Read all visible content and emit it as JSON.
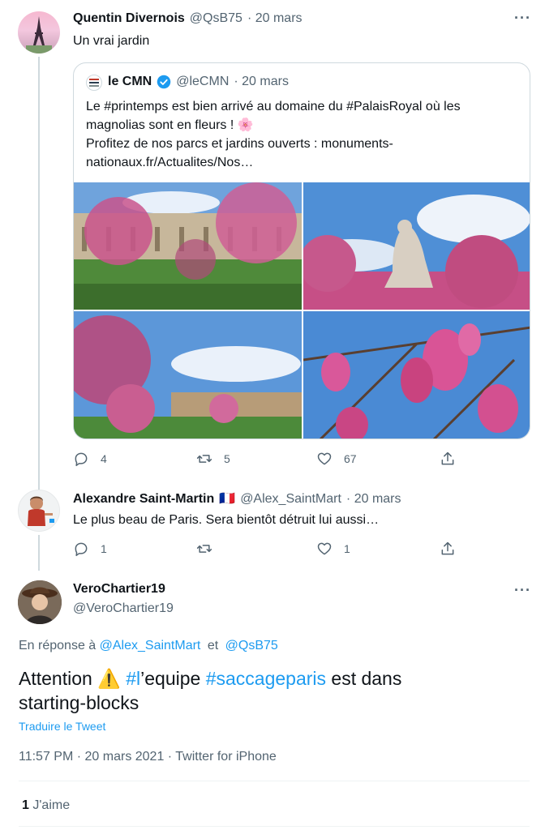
{
  "tweet1": {
    "name": "Quentin Divernois",
    "handle": "@QsB75",
    "date": "· 20 mars",
    "text": "Un vrai jardin",
    "more": "···"
  },
  "quoted": {
    "name": "le CMN",
    "handle": "@leCMN",
    "date": "· 20 mars",
    "line1_pre": "Le ",
    "line1_tag1": "#printemps",
    "line1_mid": " est bien arrivé au domaine du ",
    "line1_tag2": "#PalaisRoyal",
    "line1_post": " où les",
    "line2": "magnolias sont en fleurs ! 🌸",
    "line3": "Profitez de nos parcs et jardins ouverts : monuments-",
    "line4": "nationaux.fr/Actualites/Nos…"
  },
  "tweet1_actions": {
    "replies": "4",
    "retweets": "5",
    "likes": "67"
  },
  "tweet2": {
    "name": "Alexandre Saint-Martin",
    "flag": "🇫🇷",
    "handle": "@Alex_SaintMart",
    "date": "· 20 mars",
    "text": "Le plus beau de Paris. Sera bientôt détruit lui aussi…"
  },
  "tweet2_actions": {
    "replies": "1",
    "likes": "1"
  },
  "main": {
    "name": "VeroChartier19",
    "handle": "@VeroChartier19",
    "more": "···",
    "reply_prefix": "En réponse à",
    "reply_user1": "@Alex_SaintMart",
    "reply_and": "et",
    "reply_user2": "@QsB75",
    "text_pre": "Attention ",
    "text_emoji": "⚠️",
    "text_tag1": "#l",
    "text_mid1": "’equipe ",
    "text_tag2": "#saccageparis",
    "text_post": " est dans",
    "text_line2": "starting-blocks",
    "translate": "Traduire le Tweet",
    "timestamp": "11:57 PM · 20 mars 2021 · Twitter for iPhone",
    "likes_count": "1",
    "likes_label": "J'aime"
  }
}
